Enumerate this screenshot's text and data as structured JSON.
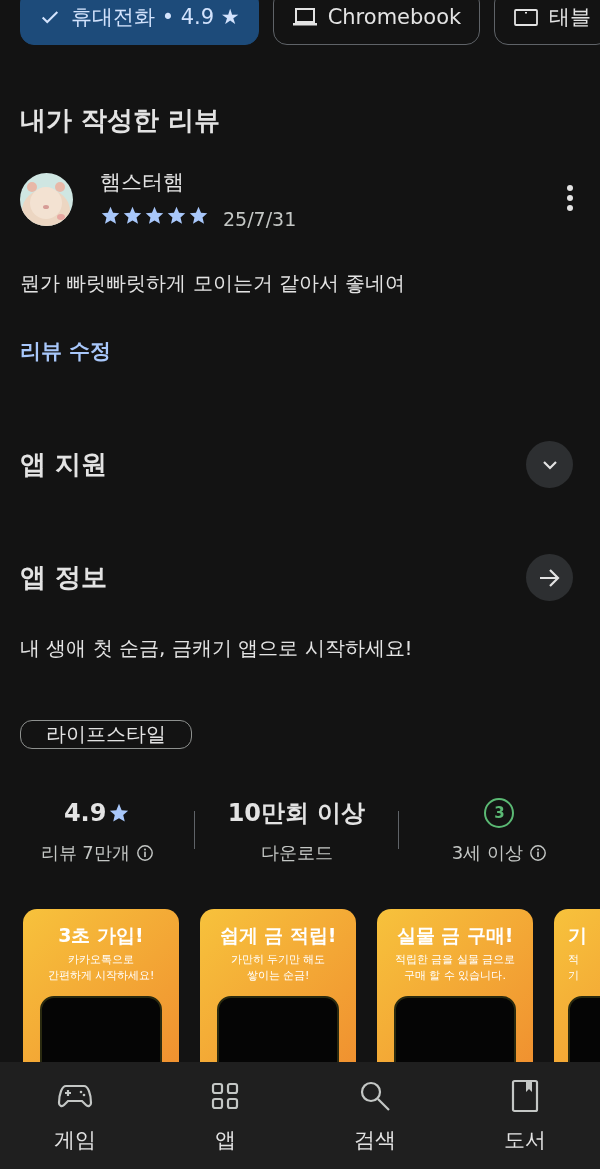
{
  "device_chips": [
    {
      "label": "휴대전화 • 4.9 ★",
      "kind": "phone",
      "selected": true
    },
    {
      "label": "Chromebook",
      "kind": "laptop",
      "selected": false
    },
    {
      "label": "태블",
      "kind": "tablet",
      "selected": false
    }
  ],
  "my_review": {
    "title": "내가 작성한 리뷰",
    "author": "햄스터햄",
    "stars": 5,
    "date": "25/7/31",
    "text": "뭔가 빠릿빠릿하게 모이는거 같아서 좋네여",
    "edit_link": "리뷰 수정"
  },
  "app_support": {
    "title": "앱 지원"
  },
  "app_info": {
    "title": "앱 정보",
    "description": "내 생애 첫 순금, 금캐기 앱으로 시작하세요!",
    "category": "라이프스타일"
  },
  "stats": [
    {
      "kind": "rating",
      "value": "4.9",
      "label": "리뷰 7만개"
    },
    {
      "kind": "plain",
      "value": "10만회 이상",
      "label": "다운로드"
    },
    {
      "kind": "age",
      "value": "3",
      "label": "3세 이상"
    }
  ],
  "screenshots": [
    {
      "title": "3초 가입!",
      "lines": [
        "카카오톡으로",
        "간편하게 시작하세요!"
      ]
    },
    {
      "title": "쉽게 금 적립!",
      "lines": [
        "가만히 두기만 해도",
        "쌓이는 순금!"
      ]
    },
    {
      "title": "실물 금 구매!",
      "lines": [
        "적립한 금을 실물 금으로",
        "구매 할 수 있습니다."
      ]
    },
    {
      "title": "기",
      "lines": [
        "적",
        "기"
      ]
    }
  ],
  "bottom_nav": [
    {
      "label": "게임",
      "kind": "games"
    },
    {
      "label": "앱",
      "kind": "apps"
    },
    {
      "label": "검색",
      "kind": "search"
    },
    {
      "label": "도서",
      "kind": "books"
    }
  ]
}
